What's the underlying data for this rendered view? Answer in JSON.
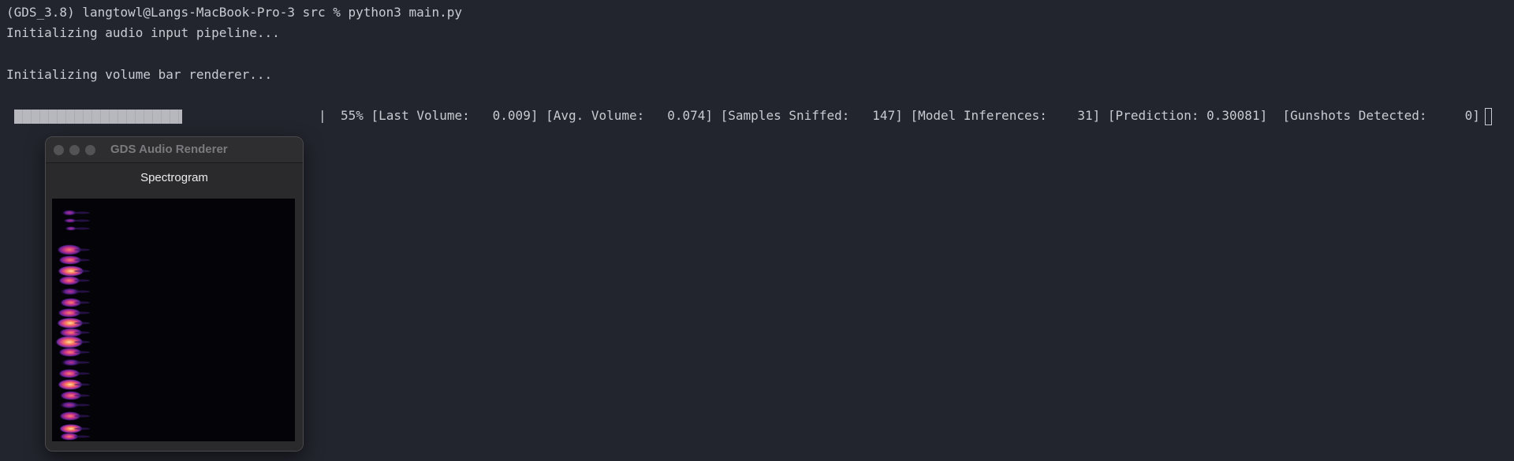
{
  "terminal": {
    "prompt_line": "(GDS_3.8) langtowl@Langs-MacBook-Pro-3 src % python3 main.py",
    "line2": "Initializing audio input pipeline...",
    "line3": "Initializing volume bar renderer...",
    "progress": {
      "left_edge": "|",
      "right_edge": "|",
      "percent_value": 0.55,
      "stats_text": "55% [Last Volume:   0.009] [Avg. Volume:   0.074] [Samples Sniffed:   147] [Model Inferences:    31] [Prediction: 0.30081]  [Gunshots Detected:     0]"
    }
  },
  "window": {
    "title": "GDS Audio Renderer",
    "buttons": [
      "close",
      "minimize",
      "maximize"
    ],
    "plot_title": "Spectrogram",
    "colormap": "magma"
  }
}
